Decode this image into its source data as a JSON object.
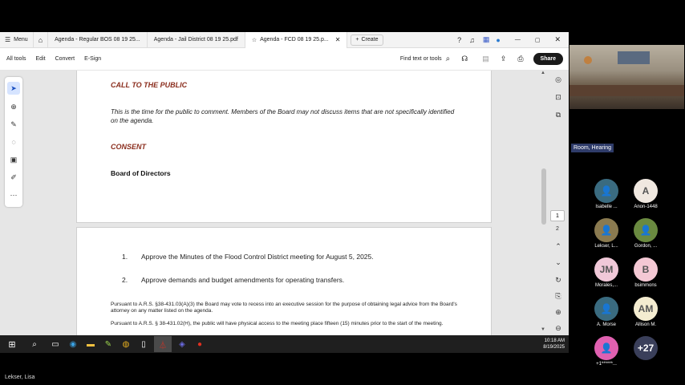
{
  "tabs": {
    "menu": "Menu",
    "items": [
      {
        "label": "Agenda - Regular BOS 08 19 25..."
      },
      {
        "label": "Agenda - Jail District 08 19 25.pdf"
      },
      {
        "label": "Agenda - FCD 08 19 25.p..."
      }
    ],
    "create": "Create"
  },
  "toolbar": {
    "all_tools": "All tools",
    "edit": "Edit",
    "convert": "Convert",
    "esign": "E-Sign",
    "find": "Find text or tools",
    "share": "Share"
  },
  "document": {
    "call_heading": "CALL TO THE PUBLIC",
    "call_text": "This is the time for the public to comment. Members of the Board may not discuss items that are not specifically identified on the agenda.",
    "consent_heading": "CONSENT",
    "board_heading": "Board of Directors",
    "items": [
      {
        "num": "1.",
        "text": "Approve the Minutes of the Flood Control District meeting for August 5, 2025."
      },
      {
        "num": "2.",
        "text": "Approve demands and budget amendments for operating transfers."
      }
    ],
    "para1": "Pursuant to A.R.S. §38-431.03(A)(3) the Board may vote to recess into an executive session for the purpose of obtaining legal advice from the Board's attorney on any matter listed on the agenda.",
    "para2": "Pursuant to A.R.S. § 38-431.02(H), the public will have physical access to the meeting place fifteen (15) minutes prior to the start of the meeting."
  },
  "page_nav": {
    "page1": "1",
    "page2": "2"
  },
  "taskbar": {
    "time": "10:18 AM",
    "date": "8/19/2025"
  },
  "meeting": {
    "room_label": "Room, Hearing",
    "participants": [
      {
        "initials": "",
        "name": "Isabelle ...",
        "color": "#3a6b80"
      },
      {
        "initials": "A",
        "name": "Anon-1448",
        "color": "#f0e8e0"
      },
      {
        "initials": "",
        "name": "Lekser, L...",
        "color": "#8a7a50"
      },
      {
        "initials": "",
        "name": "Gordon, ...",
        "color": "#6a8a40"
      },
      {
        "initials": "JM",
        "name": "Morales,...",
        "color": "#f0c8d8"
      },
      {
        "initials": "B",
        "name": "bsimmons",
        "color": "#f4c8d4"
      },
      {
        "initials": "",
        "name": "A. Morse",
        "color": "#3a6b80"
      },
      {
        "initials": "AM",
        "name": "Allison M.",
        "color": "#f4ecd0"
      },
      {
        "initials": "",
        "name": "+1******...",
        "color": "#e060b0"
      },
      {
        "initials": "+27",
        "name": "",
        "color": "#3a3f5a"
      }
    ],
    "active_speaker": "Lekser, Lisa"
  }
}
